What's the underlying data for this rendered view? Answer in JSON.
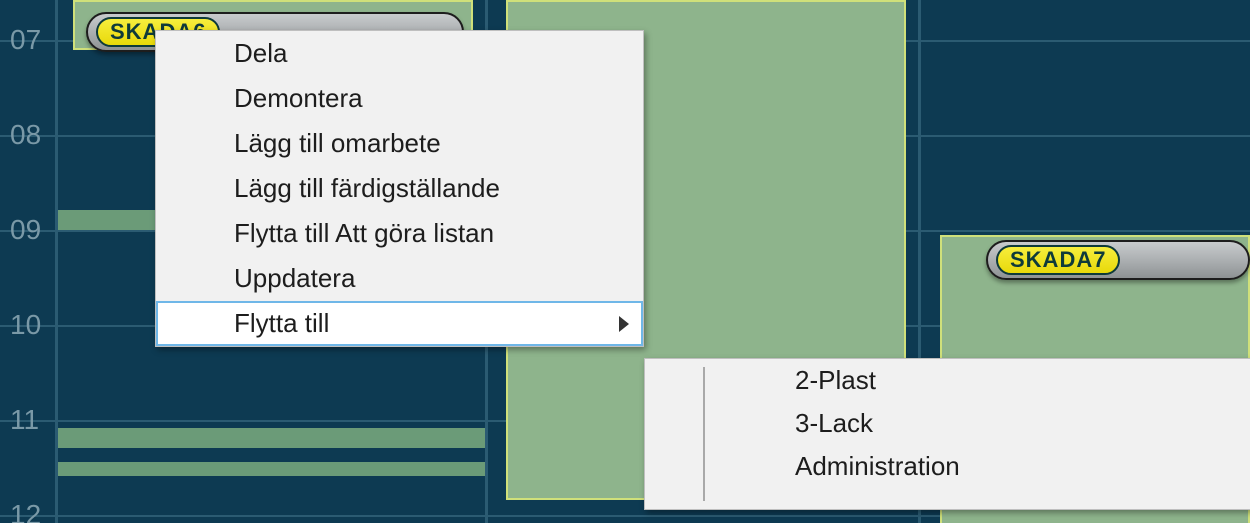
{
  "hours": {
    "h07": "07",
    "h08": "08",
    "h09": "09",
    "h10": "10",
    "h11": "11",
    "h12": "12"
  },
  "chips": {
    "left": {
      "label": "SKADA6"
    },
    "right": {
      "label": "SKADA7"
    }
  },
  "context_menu": {
    "dela": "Dela",
    "demontera": "Demontera",
    "lagg_till_omarbete": "Lägg till omarbete",
    "lagg_till_fardig": "Lägg till färdigställande",
    "flytta_att_gora": "Flytta till Att göra listan",
    "uppdatera": "Uppdatera",
    "flytta_till": "Flytta till"
  },
  "submenu": {
    "plast": "2-Plast",
    "lack": "3-Lack",
    "admin": "Administration"
  }
}
